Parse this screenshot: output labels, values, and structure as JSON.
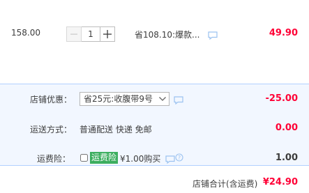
{
  "item": {
    "unit_price": "158.00",
    "quantity": "1",
    "promotion": "省108.10:爆款...",
    "subtotal": "49.90"
  },
  "shop_discount": {
    "label": "店铺优惠：",
    "selected": "省25元:收腹带9号",
    "amount": "-25.00"
  },
  "shipping": {
    "label": "运送方式：",
    "method": "普通配送 快递 免邮",
    "amount": "0.00"
  },
  "insurance": {
    "label": "运费险：",
    "tag": "运费险",
    "price": "¥1.00购买",
    "amount": "1.00"
  },
  "footer": {
    "total_label": "店铺合计(含运费)",
    "total": "¥24.90"
  },
  "colors": {
    "price_red": "#ff0036",
    "summary_bg": "#f2f7ff",
    "summary_border": "#b2d1ff",
    "insure_green": "#3cae5f",
    "chat_blue": "#9bc2f0"
  },
  "icons": [
    "minus-icon",
    "plus-icon",
    "chat-icon",
    "chevron-down-icon"
  ]
}
